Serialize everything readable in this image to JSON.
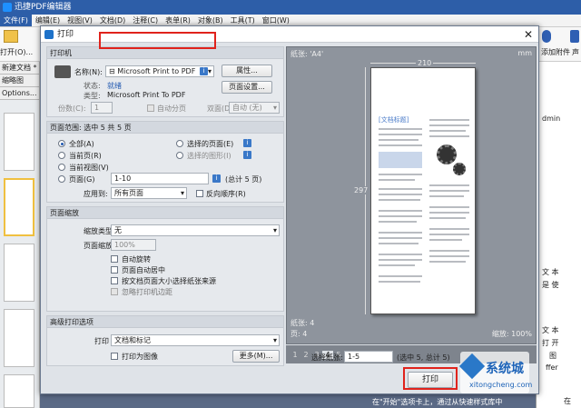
{
  "app": {
    "title": "迅捷PDF编辑器"
  },
  "menu": [
    "文件(F)",
    "编辑(E)",
    "视图(V)",
    "文档(D)",
    "注释(C)",
    "表单(R)",
    "对象(B)",
    "工具(T)",
    "窗口(W)"
  ],
  "toolbar": {
    "open_label": "打开(O)...",
    "right_labels": [
      "添加附件",
      "声"
    ]
  },
  "left_panel": {
    "tab_label": "新建文档 *",
    "thumbs_label": "缩略图",
    "options_label": "Options..."
  },
  "right_doc": {
    "lines": [
      "dmin",
      "文 本",
      "是 使",
      "文 本",
      "打 开",
      "图",
      "ffer",
      "在"
    ]
  },
  "dialog": {
    "title": "打印",
    "printer": {
      "header": "打印机",
      "name_label": "名称(N):",
      "name_value": "Microsoft Print to PDF",
      "properties_button": "属性...",
      "status_label": "状态:",
      "status_value": "就绪",
      "type_label": "类型:",
      "type_value": "Microsoft Print To PDF",
      "page_setup_button": "页面设置...",
      "copies_label": "份数(C):",
      "copies_value": "1",
      "collate_label": "自动分页",
      "duplex_label": "双面(D):",
      "duplex_value": "自动 (无)"
    },
    "range": {
      "header": "页面范围: 选中 5 共 5 页",
      "all": "全部(A)",
      "current": "当前页(R)",
      "current_view": "当前视图(V)",
      "pages": "页面(G)",
      "selected_pages": "选择的页面(E)",
      "selected_shapes": "选择的图形(I)",
      "pages_value": "1-10",
      "total": "(总计 5 页)",
      "apply_label": "应用到:",
      "apply_value": "所有页面",
      "reverse_label": "反向顺序(R)"
    },
    "scale": {
      "header": "页面缩放",
      "type_label": "缩放类型:",
      "type_value": "无",
      "zoom_label": "页面缩放:",
      "zoom_value": "100%",
      "auto_rotate": "自动旋转",
      "auto_center": "页面自动居中",
      "paper_by_size": "按文档页面大小选择纸张来源",
      "ignore_margins": "忽略打印机边距"
    },
    "advanced": {
      "header": "高级打印选项",
      "print_label": "打印",
      "print_value": "文档和标记",
      "as_image": "打印为图像",
      "more_button": "更多(M)..."
    },
    "preview": {
      "paper_label": "纸张: 'A4'",
      "unit": "mm",
      "width": "210",
      "height": "297",
      "page_title": "[文档标题]",
      "paper_count": "纸张: 4",
      "page_count": "页: 4",
      "zoom": "缩放: 100%"
    },
    "pager": [
      "1",
      "2",
      "3",
      "4",
      "5"
    ],
    "pager_current": "4",
    "select_paper_label": "选择纸张:",
    "select_paper_value": "1-5",
    "select_paper_note": "(选中 5, 总计 5)",
    "print_button": "打印",
    "watermark": {
      "brand": "系统城",
      "url": "xitongcheng.com"
    },
    "bottom_text": "在\"开始\"选项卡上，通过从快速样式库中"
  },
  "accent_colors": {
    "highlight_red": "#e0231c",
    "title_blue": "#2d5ea8"
  }
}
